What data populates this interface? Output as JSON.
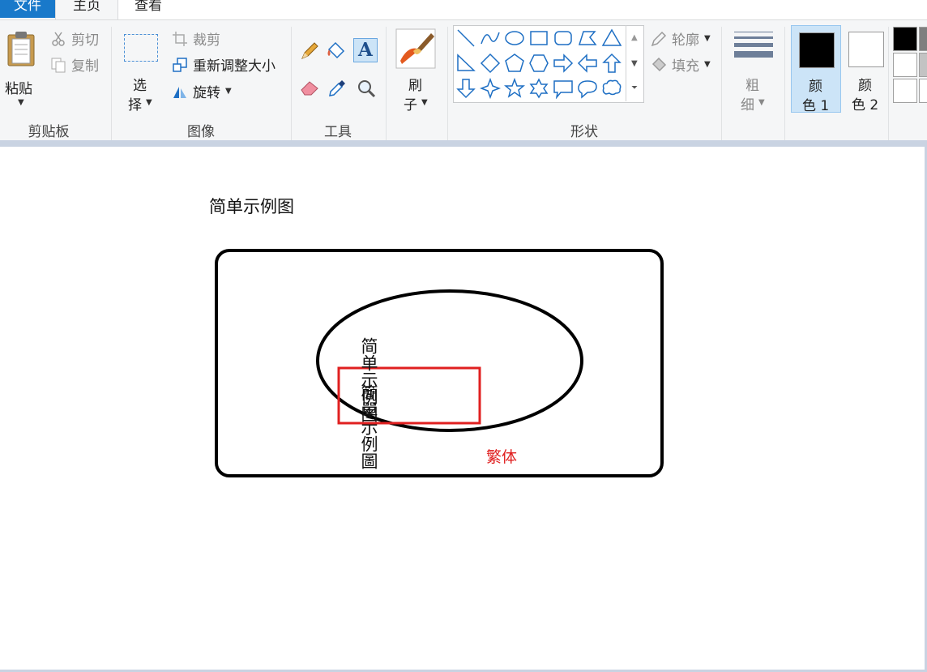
{
  "tabs": {
    "file": "文件",
    "home": "主页",
    "view": "查看"
  },
  "clipboard": {
    "paste": "粘贴",
    "cut": "剪切",
    "copy": "复制",
    "group": "剪贴板"
  },
  "image": {
    "select_line1": "选",
    "select_line2": "择",
    "crop": "裁剪",
    "resize": "重新调整大小",
    "rotate": "旋转",
    "group": "图像"
  },
  "tools": {
    "group": "工具"
  },
  "brushes": {
    "line1": "刷",
    "line2": "子"
  },
  "shapes": {
    "outline": "轮廓",
    "fill": "填充",
    "group": "形状"
  },
  "size": {
    "line1": "粗",
    "line2": "细"
  },
  "colors": {
    "color1_line1": "颜",
    "color1_line2": "色 1",
    "color1_value": "#000000",
    "color2_line1": "颜",
    "color2_line2": "色 2",
    "color2_value": "#ffffff",
    "palette": [
      "#000000",
      "#7f7f7f",
      "#ffffff",
      "#c3c3c3",
      "#ffffff",
      "#ffffff"
    ]
  },
  "canvas": {
    "title": "简单示例图",
    "simplified_text": "简单示例图",
    "traditional_text": "簡單示例圖",
    "traditional_label": "繁体"
  }
}
